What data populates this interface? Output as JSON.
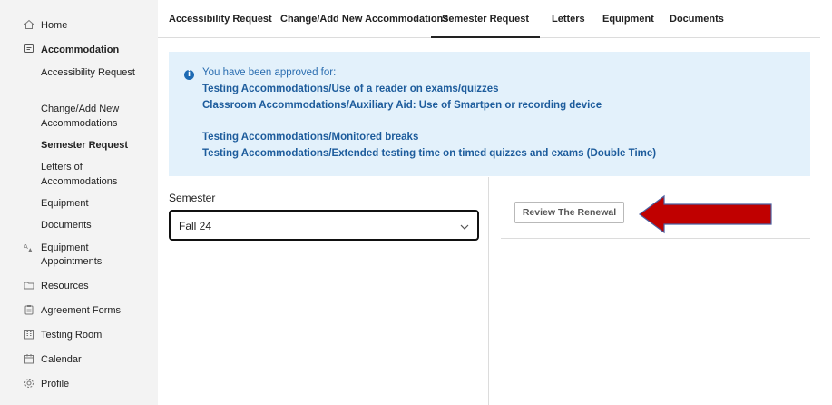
{
  "sidebar": {
    "items": [
      {
        "label": "Home",
        "icon": "home-icon"
      },
      {
        "label": "Accommodation",
        "icon": "accommodation-icon"
      },
      {
        "label": "Equipment Appointments",
        "icon": "equipment-appointments-icon"
      },
      {
        "label": "Resources",
        "icon": "folder-icon"
      },
      {
        "label": "Agreement Forms",
        "icon": "clipboard-icon"
      },
      {
        "label": "Testing Room",
        "icon": "building-icon"
      },
      {
        "label": "Calendar",
        "icon": "calendar-icon"
      },
      {
        "label": "Profile",
        "icon": "gear-icon"
      }
    ],
    "subitems": [
      {
        "label": "Accessibility Request"
      },
      {
        "label": "Change/Add New Accommodations"
      },
      {
        "label": "Semester Request"
      },
      {
        "label": "Letters of Accommodations"
      },
      {
        "label": "Equipment"
      },
      {
        "label": "Documents"
      }
    ]
  },
  "tabs": [
    {
      "label": "Accessibility Request"
    },
    {
      "label": "Change/Add New Accommodations"
    },
    {
      "label": "Semester Request"
    },
    {
      "label": "Letters"
    },
    {
      "label": "Equipment"
    },
    {
      "label": "Documents"
    }
  ],
  "active_tab": "Semester Request",
  "alert": {
    "intro": "You have been approved for:",
    "accommodations": [
      "Testing Accommodations/Use of a reader on exams/quizzes",
      "Classroom Accommodations/Auxiliary Aid: Use of Smartpen or recording device",
      "Testing Accommodations/Monitored breaks",
      "Testing Accommodations/Extended testing time on timed quizzes and exams (Double Time)"
    ]
  },
  "semester": {
    "label": "Semester",
    "selected": "Fall 24"
  },
  "review_button": "Review The Renewal",
  "colors": {
    "alert_bg": "#e3f1fb",
    "alert_text": "#1d5c9c",
    "arrow": "#c00000",
    "sidebar_bg": "#f3f3f3"
  }
}
